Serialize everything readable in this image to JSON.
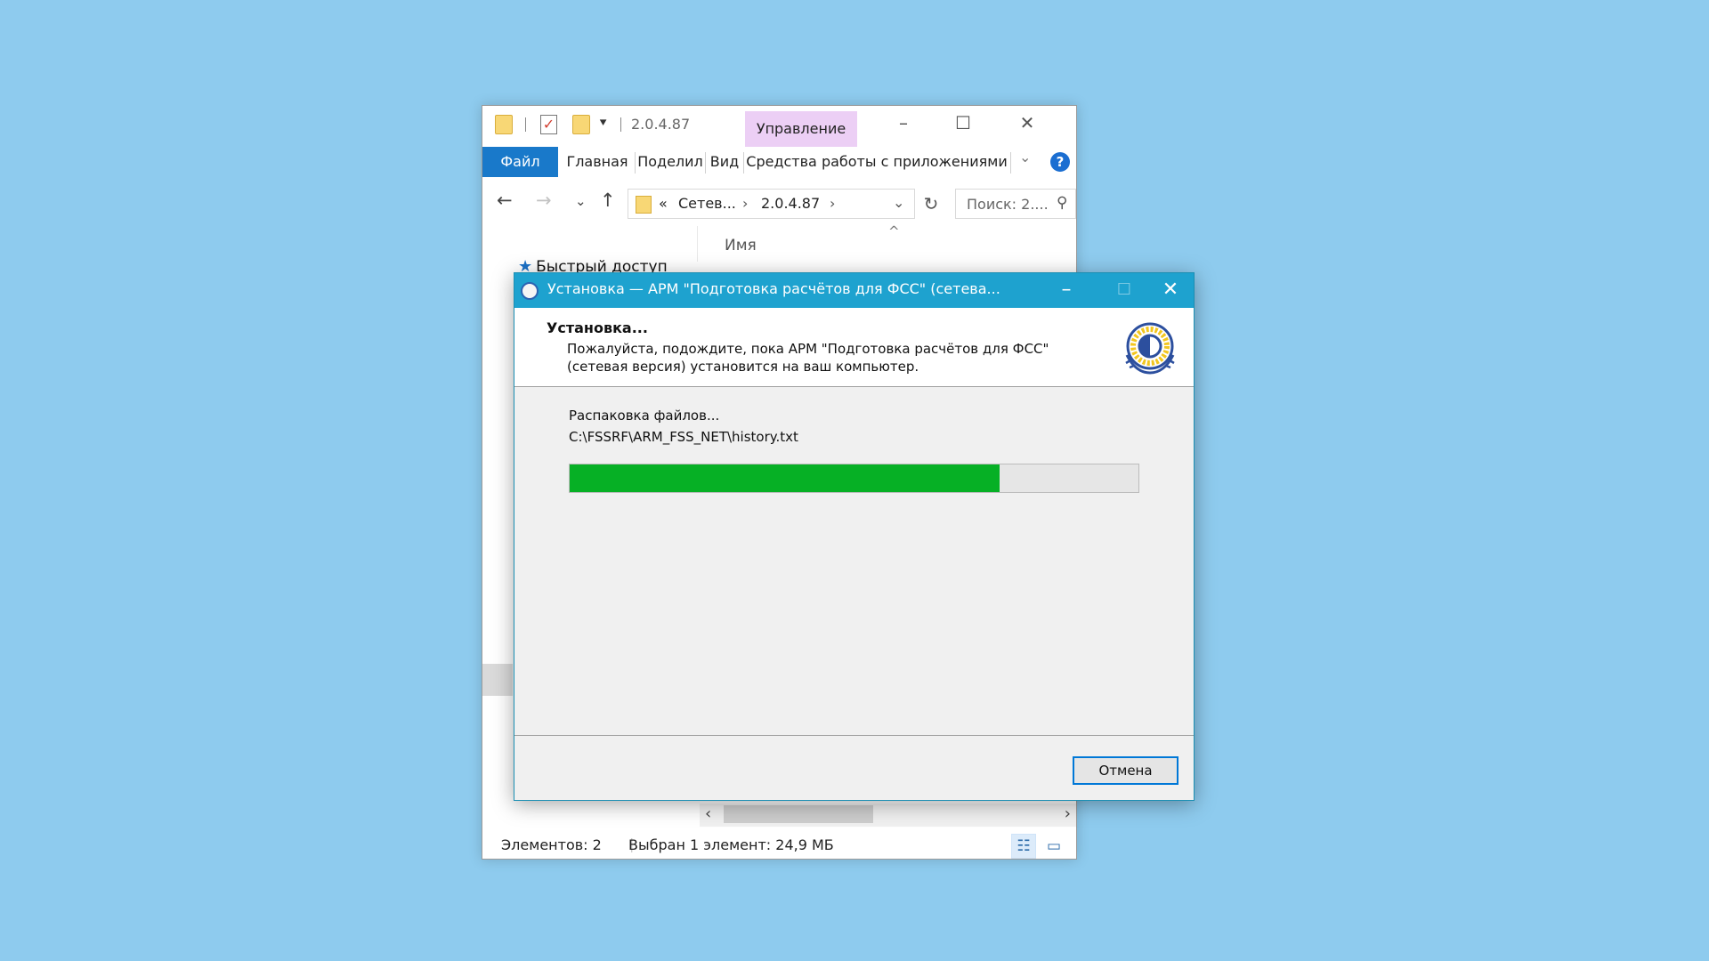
{
  "explorer": {
    "title": "2.0.4.87",
    "manage_tab": "Управление",
    "ribbon_tabs": [
      "Файл",
      "Главная",
      "Поделиться",
      "Вид",
      "Средства работы с приложениями"
    ],
    "ribbon_tabs_display": [
      "Файл",
      "Главная",
      "Поделил",
      "Вид",
      "Средства работы с приложениями"
    ],
    "address": {
      "prefix": "«",
      "segment1": "Сетев...",
      "segment2": "2.0.4.87"
    },
    "search_placeholder": "Поиск: 2....",
    "column_name": "Имя",
    "quick_access": "Быстрый доступ",
    "status": {
      "items": "Элементов: 2",
      "selected": "Выбран 1 элемент: 24,9 МБ"
    }
  },
  "dialog": {
    "title": "Установка — АРМ \"Подготовка расчётов для ФСС\" (сетева...",
    "header_title": "Установка...",
    "header_desc": "Пожалуйста, подождите, пока АРМ \"Подготовка расчётов для ФСС\" (сетевая версия) установится на ваш компьютер.",
    "status_line": "Распаковка файлов...",
    "current_file": "C:\\FSSRF\\ARM_FSS_NET\\history.txt",
    "progress_percent": 75.6,
    "cancel_label": "Отмена"
  },
  "colors": {
    "desktop": "#8ecbee",
    "dialog_titlebar": "#1ea2cf",
    "progress_fill": "#06b025",
    "file_tab": "#1979ca",
    "manage_tab": "#eccff5"
  },
  "icons": [
    "folder-icon",
    "properties-check-icon",
    "back-arrow-icon",
    "forward-arrow-icon",
    "up-arrow-icon",
    "refresh-icon",
    "search-icon",
    "help-icon",
    "star-icon",
    "installer-app-icon",
    "fss-logo-icon"
  ]
}
